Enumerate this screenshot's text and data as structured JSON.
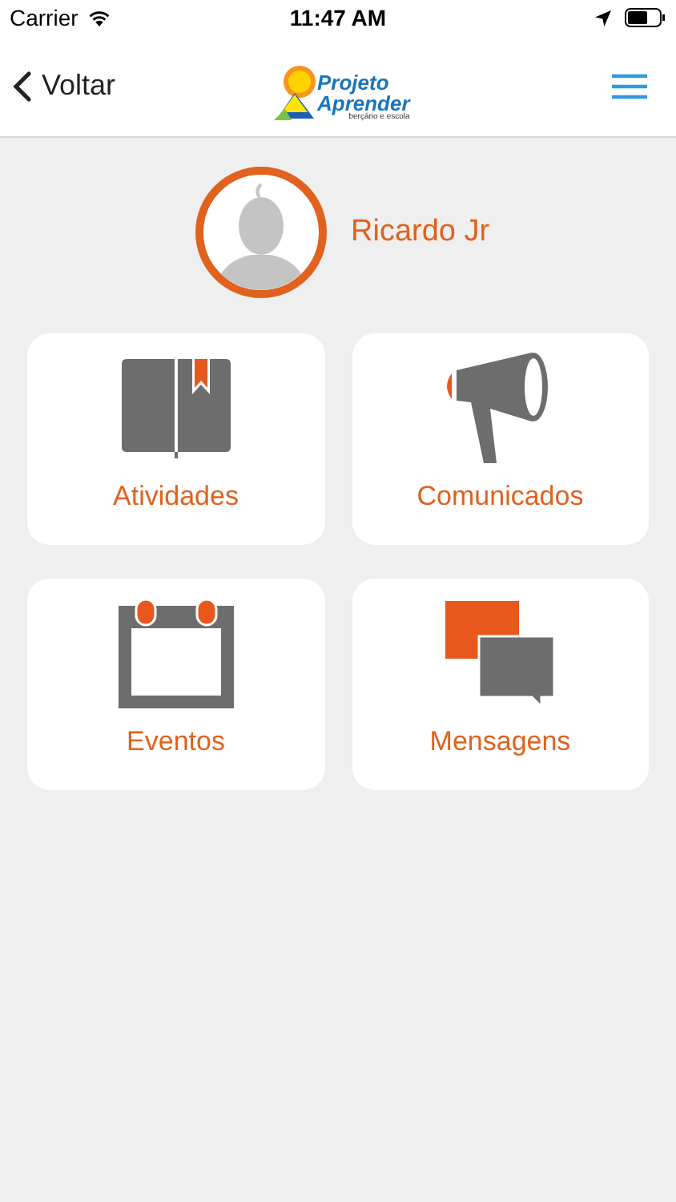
{
  "status_bar": {
    "carrier": "Carrier",
    "time": "11:47 AM"
  },
  "nav_bar": {
    "back_label": "Voltar",
    "logo": {
      "line_1": "Projeto",
      "line_2": "Aprender",
      "tagline": "berçário e escola"
    }
  },
  "profile": {
    "name": "Ricardo Jr"
  },
  "tiles": [
    {
      "kind": "book",
      "label": "Atividades"
    },
    {
      "kind": "megaphone",
      "label": "Comunicados"
    },
    {
      "kind": "calendar",
      "label": "Eventos"
    },
    {
      "kind": "chat",
      "label": "Mensagens"
    }
  ]
}
